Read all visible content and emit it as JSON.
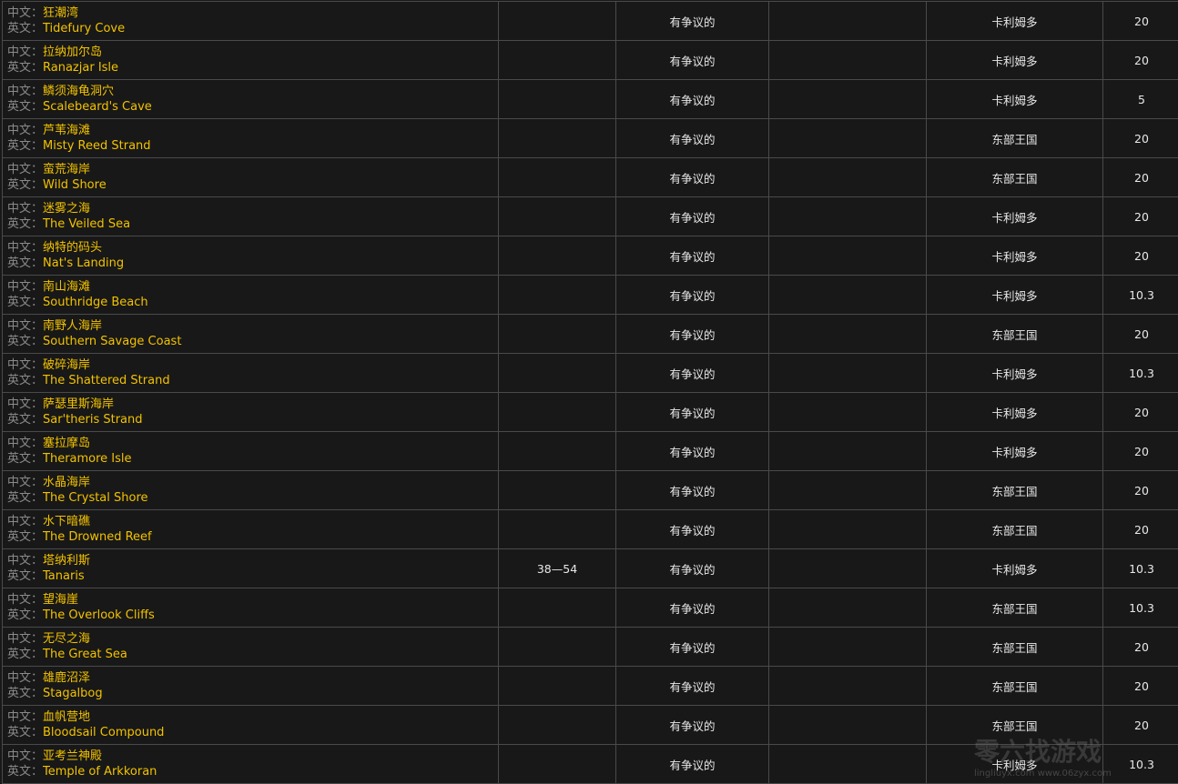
{
  "labels": {
    "cn": "中文：",
    "en": "英文："
  },
  "watermark": {
    "text": "零六找游戏",
    "url": "lingliuyx.com   www.06zyx.com"
  },
  "rows": [
    {
      "cn": "狂潮湾",
      "en": "Tidefury Cove",
      "level": "",
      "status": "有争议的",
      "continent": "卡利姆多",
      "value": "20"
    },
    {
      "cn": "拉纳加尔岛",
      "en": "Ranazjar Isle",
      "level": "",
      "status": "有争议的",
      "continent": "卡利姆多",
      "value": "20"
    },
    {
      "cn": "鳞须海龟洞穴",
      "en": "Scalebeard's Cave",
      "level": "",
      "status": "有争议的",
      "continent": "卡利姆多",
      "value": "5"
    },
    {
      "cn": "芦苇海滩",
      "en": "Misty Reed Strand",
      "level": "",
      "status": "有争议的",
      "continent": "东部王国",
      "value": "20"
    },
    {
      "cn": "蛮荒海岸",
      "en": "Wild Shore",
      "level": "",
      "status": "有争议的",
      "continent": "东部王国",
      "value": "20"
    },
    {
      "cn": "迷雾之海",
      "en": "The Veiled Sea",
      "level": "",
      "status": "有争议的",
      "continent": "卡利姆多",
      "value": "20"
    },
    {
      "cn": "纳特的码头",
      "en": "Nat's Landing",
      "level": "",
      "status": "有争议的",
      "continent": "卡利姆多",
      "value": "20"
    },
    {
      "cn": "南山海滩",
      "en": "Southridge Beach",
      "level": "",
      "status": "有争议的",
      "continent": "卡利姆多",
      "value": "10.3"
    },
    {
      "cn": "南野人海岸",
      "en": "Southern Savage Coast",
      "level": "",
      "status": "有争议的",
      "continent": "东部王国",
      "value": "20"
    },
    {
      "cn": "破碎海岸",
      "en": "The Shattered Strand",
      "level": "",
      "status": "有争议的",
      "continent": "卡利姆多",
      "value": "10.3"
    },
    {
      "cn": "萨瑟里斯海岸",
      "en": "Sar'theris Strand",
      "level": "",
      "status": "有争议的",
      "continent": "卡利姆多",
      "value": "20"
    },
    {
      "cn": "塞拉摩岛",
      "en": "Theramore Isle",
      "level": "",
      "status": "有争议的",
      "continent": "卡利姆多",
      "value": "20"
    },
    {
      "cn": "水晶海岸",
      "en": "The Crystal Shore",
      "level": "",
      "status": "有争议的",
      "continent": "东部王国",
      "value": "20"
    },
    {
      "cn": "水下暗礁",
      "en": "The Drowned Reef",
      "level": "",
      "status": "有争议的",
      "continent": "东部王国",
      "value": "20"
    },
    {
      "cn": "塔纳利斯",
      "en": "Tanaris",
      "level": "38—54",
      "status": "有争议的",
      "continent": "卡利姆多",
      "value": "10.3"
    },
    {
      "cn": "望海崖",
      "en": "The Overlook Cliffs",
      "level": "",
      "status": "有争议的",
      "continent": "东部王国",
      "value": "10.3"
    },
    {
      "cn": "无尽之海",
      "en": "The Great Sea",
      "level": "",
      "status": "有争议的",
      "continent": "东部王国",
      "value": "20"
    },
    {
      "cn": "雄鹿沼泽",
      "en": "Stagalbog",
      "level": "",
      "status": "有争议的",
      "continent": "东部王国",
      "value": "20"
    },
    {
      "cn": "血帆营地",
      "en": "Bloodsail Compound",
      "level": "",
      "status": "有争议的",
      "continent": "东部王国",
      "value": "20"
    },
    {
      "cn": "亚考兰神殿",
      "en": "Temple of Arkkoran",
      "level": "",
      "status": "有争议的",
      "continent": "卡利姆多",
      "value": "10.3"
    }
  ]
}
